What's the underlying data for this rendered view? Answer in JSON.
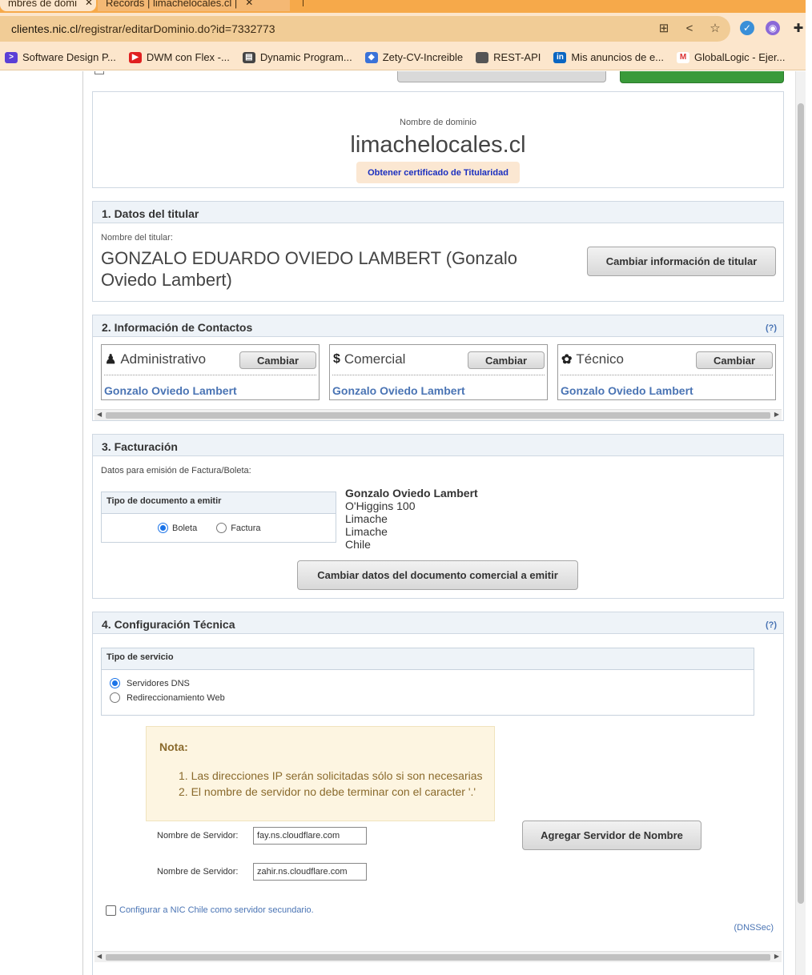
{
  "browser": {
    "tabs": [
      {
        "label": "mbres de domi",
        "close": "✕"
      },
      {
        "label": "Records | limachelocales.cl |",
        "close": "✕"
      }
    ],
    "url_host": "clientes.nic.cl",
    "url_path": "/registrar/editarDominio.do?id=7332773",
    "bookmarks": [
      {
        "label": "Software Design P...",
        "icon": "terminal-icon",
        "color": "#5b3fd6"
      },
      {
        "label": "DWM con Flex -...",
        "icon": "youtube-icon",
        "color": "#e02020"
      },
      {
        "label": "Dynamic Program...",
        "icon": "code-icon",
        "color": "#444444"
      },
      {
        "label": "Zety-CV-Increible",
        "icon": "cube-icon",
        "color": "#3a72d8"
      },
      {
        "label": "REST-API",
        "icon": "folder-icon",
        "color": "#555555"
      },
      {
        "label": "Mis anuncios de e...",
        "icon": "linkedin-icon",
        "color": "#0a66c2"
      },
      {
        "label": "GlobalLogic - Ejer...",
        "icon": "gmail-icon",
        "color": "#ffffff"
      }
    ]
  },
  "domain": {
    "label": "Nombre de dominio",
    "name": "limachelocales.cl",
    "cert_link": "Obtener certificado de Titularidad"
  },
  "titular": {
    "heading": "1. Datos del titular",
    "label": "Nombre del titular:",
    "name": "GONZALO EDUARDO OVIEDO LAMBERT (Gonzalo Oviedo Lambert)",
    "change_button": "Cambiar información de titular"
  },
  "contacts": {
    "heading": "2. Información de Contactos",
    "help": "(?)",
    "cards": [
      {
        "title": "Administrativo",
        "icon": "user-icon",
        "glyph": "♟",
        "button": "Cambiar",
        "name": "Gonzalo Oviedo Lambert"
      },
      {
        "title": "Comercial",
        "icon": "dollar-icon",
        "glyph": "$",
        "button": "Cambiar",
        "name": "Gonzalo Oviedo Lambert"
      },
      {
        "title": "Técnico",
        "icon": "gear-icon",
        "glyph": "✿",
        "button": "Cambiar",
        "name": "Gonzalo Oviedo Lambert"
      }
    ]
  },
  "billing": {
    "heading": "3. Facturación",
    "label": "Datos para emisión de Factura/Boleta:",
    "doc_type_heading": "Tipo de documento a emitir",
    "options": [
      {
        "label": "Boleta",
        "selected": true
      },
      {
        "label": "Factura",
        "selected": false
      }
    ],
    "address": {
      "name": "Gonzalo Oviedo Lambert",
      "street": "O'Higgins 100",
      "city": "Limache",
      "region": "Limache",
      "country": "Chile"
    },
    "change_button": "Cambiar datos del documento comercial a emitir"
  },
  "technical": {
    "heading": "4. Configuración Técnica",
    "help": "(?)",
    "service_heading": "Tipo de servicio",
    "services": [
      {
        "label": "Servidores DNS",
        "selected": true
      },
      {
        "label": "Redireccionamiento Web",
        "selected": false
      }
    ],
    "note_title": "Nota:",
    "notes": [
      "1. Las direcciones IP serán solicitadas sólo si son necesarias",
      "2. El nombre de servidor no debe terminar con el caracter '.'"
    ],
    "ns_label": "Nombre de Servidor:",
    "nameservers": [
      "fay.ns.cloudflare.com",
      "zahir.ns.cloudflare.com"
    ],
    "add_button": "Agregar Servidor de Nombre",
    "secondary_label": "Configurar a NIC Chile como servidor secundario.",
    "dnssec": "(DNSSec)"
  }
}
